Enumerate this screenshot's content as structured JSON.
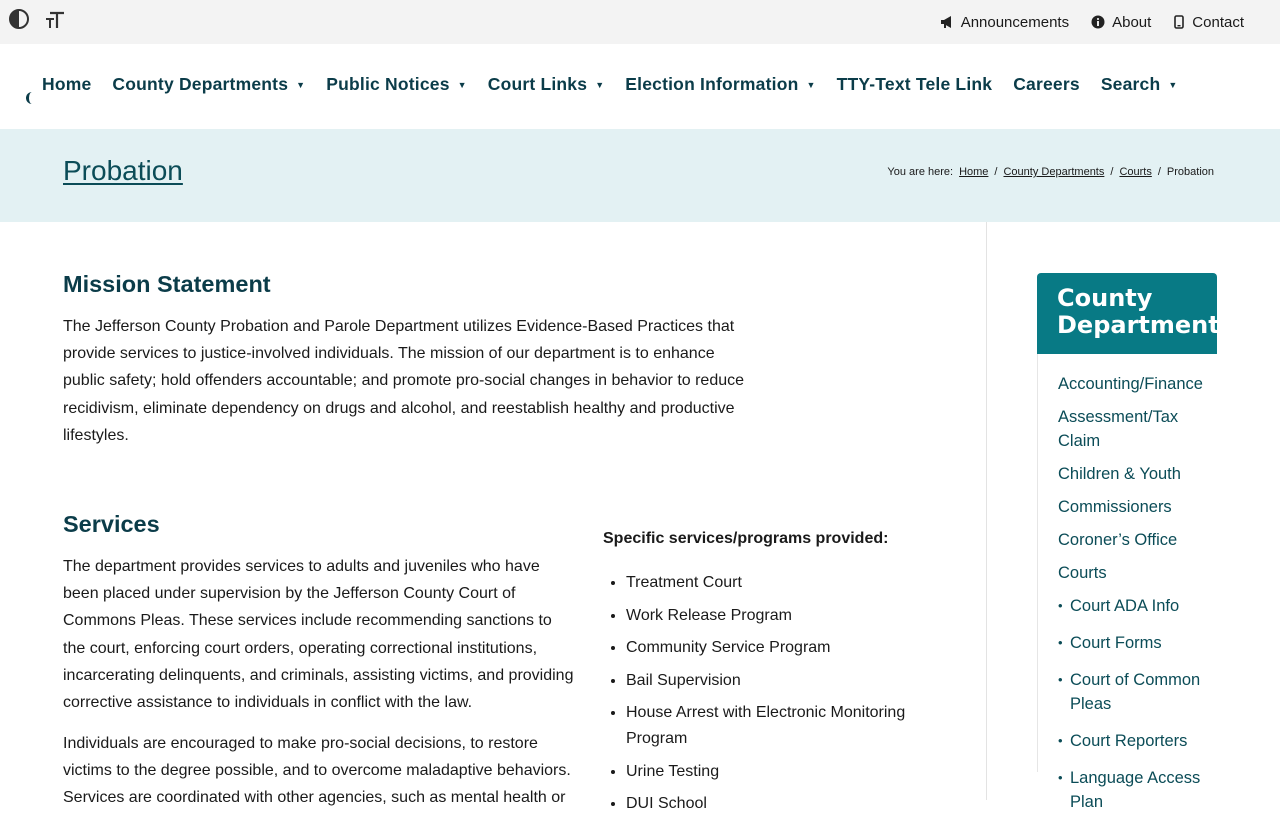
{
  "utility": {
    "left_icons": [
      "contrast-icon",
      "text-size-icon"
    ],
    "links": [
      {
        "label": "Announcements",
        "icon": "megaphone-icon"
      },
      {
        "label": "About",
        "icon": "info-icon"
      },
      {
        "label": "Contact",
        "icon": "phone-icon"
      }
    ]
  },
  "nav": {
    "items": [
      {
        "label": "Home",
        "has_dropdown": false
      },
      {
        "label": "County Departments",
        "has_dropdown": true
      },
      {
        "label": "Public Notices",
        "has_dropdown": true
      },
      {
        "label": "Court Links",
        "has_dropdown": true
      },
      {
        "label": "Election Information",
        "has_dropdown": true
      },
      {
        "label": "TTY-Text Tele Link",
        "has_dropdown": false
      },
      {
        "label": "Careers",
        "has_dropdown": false
      },
      {
        "label": "Search",
        "has_dropdown": true
      }
    ],
    "caret": "▼"
  },
  "page": {
    "title": "Probation"
  },
  "breadcrumb": {
    "prefix": "You are here:",
    "items": [
      "Home",
      "County Departments",
      "Courts"
    ],
    "current": "Probation",
    "separator": "/"
  },
  "mission": {
    "heading": "Mission Statement",
    "text": "The Jefferson County Probation and Parole Department utilizes Evidence-Based Practices that provide services to justice-involved individuals.  The mission of our department is to enhance public safety; hold offenders accountable; and promote pro-social changes in behavior to reduce recidivism, eliminate dependency on drugs and alcohol, and reestablish healthy and productive lifestyles."
  },
  "services": {
    "heading": "Services",
    "paragraph1": "The department provides services to adults and juveniles who have been placed under supervision by the Jefferson County Court of Commons Pleas. These services include recommending sanctions to the court, enforcing court orders, operating correctional institutions, incarcerating delinquents, and criminals, assisting victims, and providing corrective assistance to individuals in conflict with the law.",
    "paragraph2": "Individuals are encouraged to make pro-social decisions, to restore victims to the degree possible, and to overcome maladaptive behaviors. Services are coordinated with other agencies, such as mental health or",
    "programs_heading": "Specific services/programs provided:",
    "programs": [
      "Treatment Court",
      "Work Release Program",
      "Community Service Program",
      "Bail Supervision",
      "House Arrest with Electronic Monitoring Program",
      "Urine Testing",
      "DUI School"
    ]
  },
  "sidebar": {
    "title": "County Departments",
    "links": [
      "Accounting/Finance",
      "Assessment/Tax Claim",
      "Children & Youth",
      "Commissioners",
      "Coroner’s Office",
      "Courts"
    ],
    "sub_links": [
      "Court ADA Info",
      "Court Forms",
      "Court of Common Pleas",
      "Court Reporters",
      "Language Access Plan"
    ],
    "bullet": "•"
  },
  "colors": {
    "nav_text": "#0b3c49",
    "title_band": "#e3f1f3",
    "sidebar_header": "#087a85",
    "link": "#0b4c57"
  }
}
